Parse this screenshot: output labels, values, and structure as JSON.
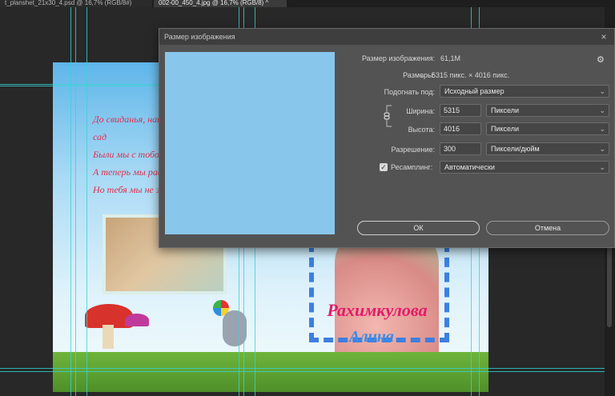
{
  "tabs": [
    {
      "label": "t_planshet_21x30_4.psd @ 16,7% (RGB/8#)",
      "close": "×"
    },
    {
      "label": "002-00_450_4.jpg @ 16,7% (RGB/8) ^",
      "close": ""
    }
  ],
  "document": {
    "poem_lines": [
      "До свиданья, наш детский сад",
      "Были мы с тобою",
      "А теперь мы расст",
      "Но тебя мы не за"
    ],
    "name_line1": "Рахимкулова",
    "name_line2": "Алина"
  },
  "dialog": {
    "title": "Размер изображения",
    "close": "×",
    "image_size_label": "Размер изображения:",
    "image_size_value": "61,1M",
    "gear_icon": "⚙",
    "dimensions_label": "Размеры:",
    "dimensions_value": "5315 пикс.  ×  4016 пикс.",
    "fit_to_label": "Подогнать под:",
    "fit_to_value": "Исходный размер",
    "width_label": "Ширина:",
    "width_value": "5315",
    "width_unit": "Пиксели",
    "height_label": "Высота:",
    "height_value": "4016",
    "height_unit": "Пиксели",
    "resolution_label": "Разрешение:",
    "resolution_value": "300",
    "resolution_unit": "Пиксели/дюйм",
    "resample_label": "Ресамплинг:",
    "resample_value": "Автоматически",
    "ok_label": "ОК",
    "cancel_label": "Отмена"
  }
}
